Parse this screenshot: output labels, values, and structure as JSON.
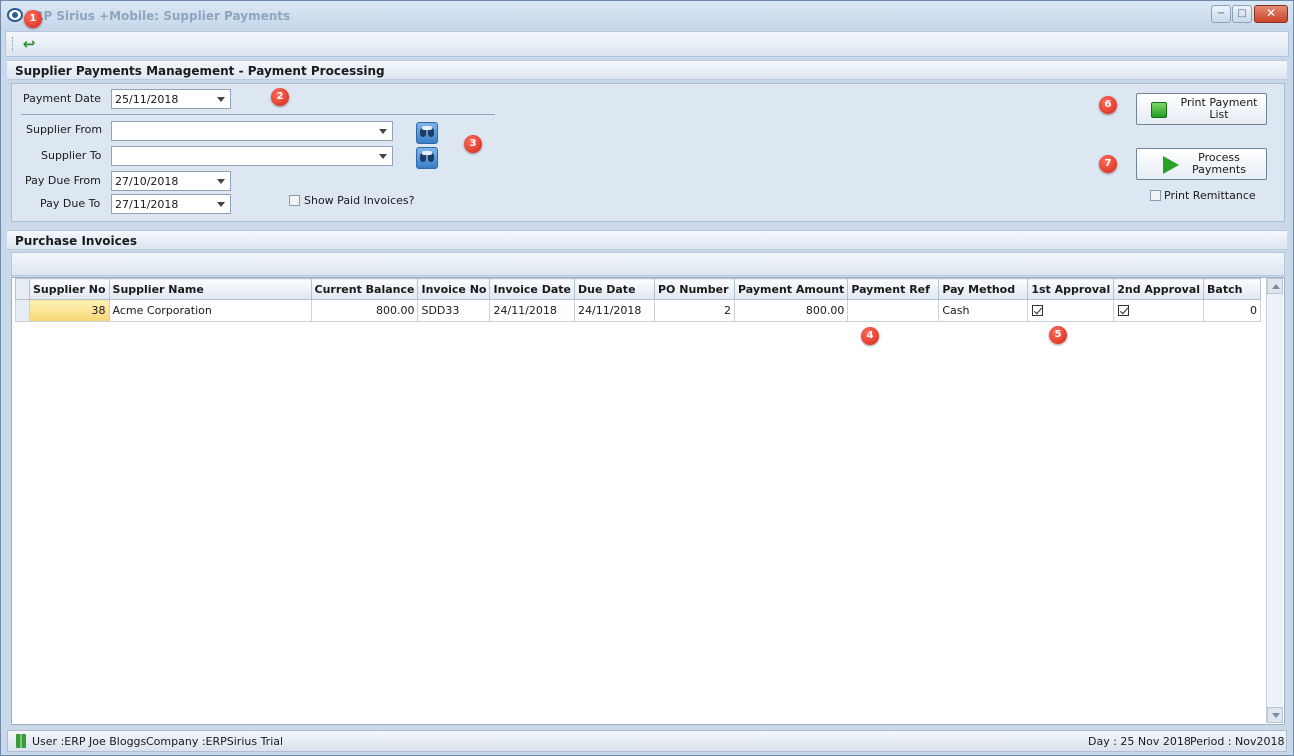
{
  "window": {
    "title": "ERP Sirius +Mobile: Supplier Payments",
    "controls": {
      "minimize": "−",
      "maximize": "□",
      "close": "✕"
    }
  },
  "toolbar": {
    "undo_icon": "undo-arrow-icon"
  },
  "sections": {
    "management_title": "Supplier Payments Management - Payment Processing",
    "invoices_title": "Purchase Invoices"
  },
  "form": {
    "payment_date_label": "Payment Date",
    "payment_date_value": "25/11/2018",
    "supplier_from_label": "Supplier From",
    "supplier_from_value": "",
    "supplier_to_label": "Supplier To",
    "supplier_to_value": "",
    "pay_due_from_label": "Pay Due From",
    "pay_due_from_value": "27/10/2018",
    "pay_due_to_label": "Pay Due To",
    "pay_due_to_value": "27/11/2018",
    "show_paid_label": "Show Paid Invoices?",
    "show_paid_checked": false
  },
  "actions": {
    "print_payment_list": "Print Payment List",
    "process_payments": "Process Payments",
    "print_remittance_label": "Print Remittance",
    "print_remittance_checked": false
  },
  "badges": [
    "1",
    "2",
    "3",
    "4",
    "5",
    "6",
    "7"
  ],
  "grid": {
    "columns": [
      "Supplier No",
      "Supplier Name",
      "Current Balance",
      "Invoice No",
      "Invoice Date",
      "Due Date",
      "PO Number",
      "Payment Amount",
      "Payment Ref",
      "Pay Method",
      "1st Approval",
      "2nd Approval",
      "Batch"
    ],
    "rows": [
      {
        "supplier_no": "38",
        "supplier_name": "Acme Corporation",
        "current_balance": "800.00",
        "invoice_no": "SDD33",
        "invoice_date": "24/11/2018",
        "due_date": "24/11/2018",
        "po_number": "2",
        "payment_amount": "800.00",
        "payment_ref": "",
        "pay_method": "Cash",
        "first_approval": true,
        "second_approval": true,
        "batch": "0"
      }
    ]
  },
  "status": {
    "user": "User :ERP Joe Bloggs",
    "company": "Company :ERPSirius Trial",
    "day": "Day : 25 Nov 2018",
    "period": "Period : Nov2018"
  }
}
